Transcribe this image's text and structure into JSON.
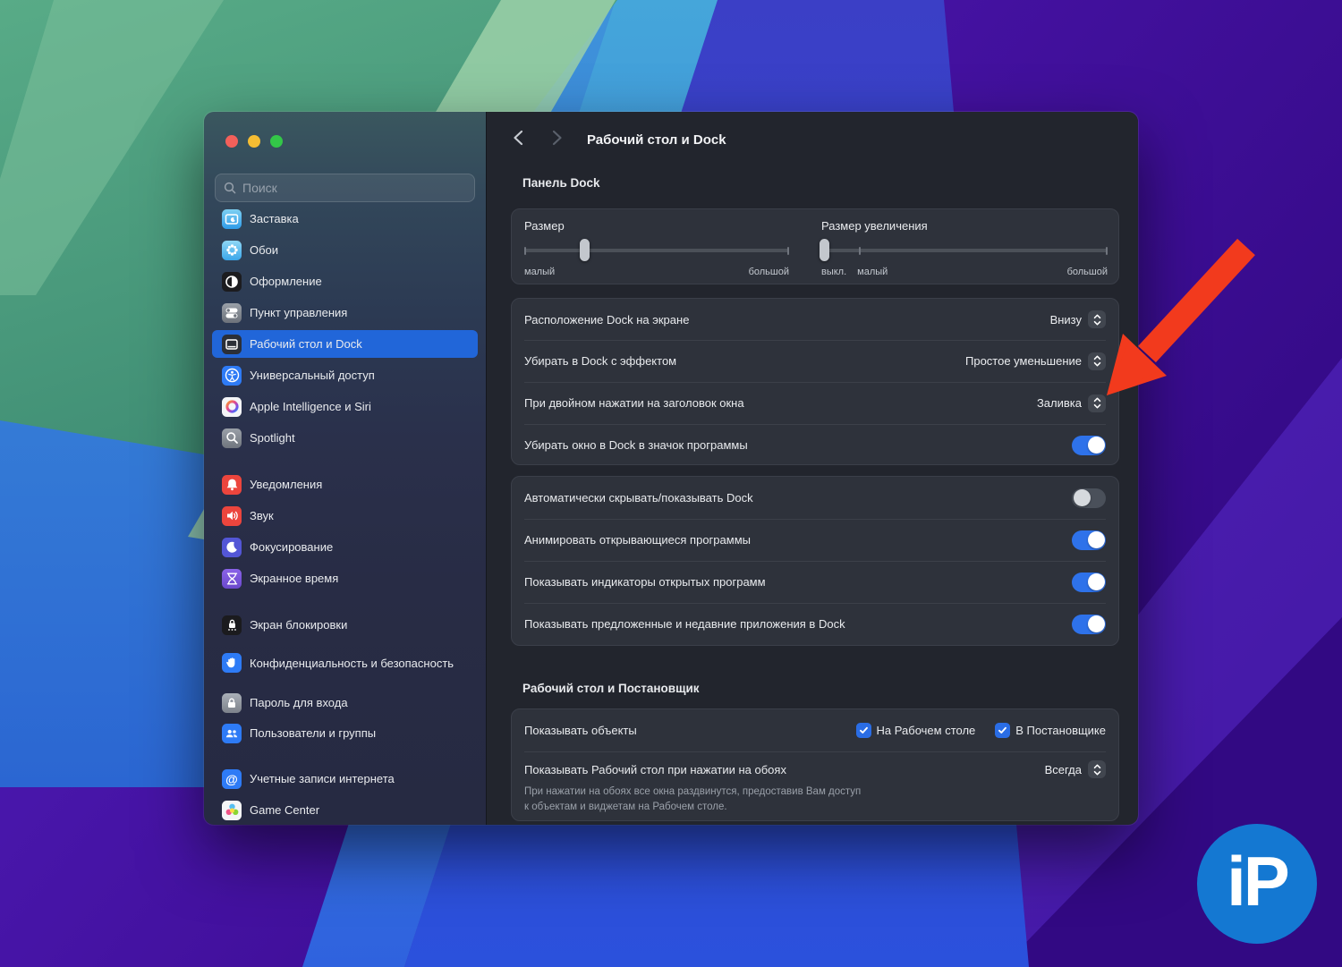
{
  "window": {
    "title": "Рабочий стол и Dock"
  },
  "sidebar": {
    "search_placeholder": "Поиск",
    "items": [
      {
        "label": "Заставка",
        "icon": "screensaver-icon",
        "selected": false
      },
      {
        "label": "Обои",
        "icon": "wallpaper-icon",
        "selected": false
      },
      {
        "label": "Оформление",
        "icon": "appearance-icon",
        "selected": false
      },
      {
        "label": "Пункт управления",
        "icon": "control-center-icon",
        "selected": false
      },
      {
        "label": "Рабочий стол и Dock",
        "icon": "desktop-dock-icon",
        "selected": true
      },
      {
        "label": "Универсальный доступ",
        "icon": "accessibility-icon",
        "selected": false
      },
      {
        "label": "Apple Intelligence и Siri",
        "icon": "apple-intelligence-icon",
        "selected": false
      },
      {
        "label": "Spotlight",
        "icon": "spotlight-icon",
        "selected": false
      },
      {
        "label": "Уведомления",
        "icon": "notifications-icon",
        "selected": false
      },
      {
        "label": "Звук",
        "icon": "sound-icon",
        "selected": false
      },
      {
        "label": "Фокусирование",
        "icon": "focus-icon",
        "selected": false
      },
      {
        "label": "Экранное время",
        "icon": "screen-time-icon",
        "selected": false
      },
      {
        "label": "Экран блокировки",
        "icon": "lock-screen-icon",
        "selected": false
      },
      {
        "label": "Конфиденциальность и безопасность",
        "icon": "privacy-icon",
        "selected": false
      },
      {
        "label": "Пароль для входа",
        "icon": "login-password-icon",
        "selected": false
      },
      {
        "label": "Пользователи и группы",
        "icon": "users-groups-icon",
        "selected": false
      },
      {
        "label": "Учетные записи интернета",
        "icon": "internet-accounts-icon",
        "selected": false
      },
      {
        "label": "Game Center",
        "icon": "game-center-icon",
        "selected": false
      }
    ]
  },
  "content": {
    "header_title": "Рабочий стол и Dock",
    "panel_dock": {
      "section_title": "Панель Dock",
      "size": {
        "label": "Размер",
        "min": "малый",
        "max": "большой",
        "value_pct": 23
      },
      "magnification": {
        "label": "Размер увеличения",
        "off": "выкл.",
        "min": "малый",
        "max": "большой",
        "value_pct": 2
      }
    },
    "dock_rows": [
      {
        "label": "Расположение Dock на экране",
        "value": "Внизу",
        "control": "dropdown"
      },
      {
        "label": "Убирать в Dock с эффектом",
        "value": "Простое уменьшение",
        "control": "dropdown"
      },
      {
        "label": "При двойном нажатии на заголовок окна",
        "value": "Заливка",
        "control": "dropdown"
      },
      {
        "label": "Убирать окно в Dock в значок программы",
        "value": "on",
        "control": "toggle"
      }
    ],
    "toggle_rows": [
      {
        "label": "Автоматически скрывать/показывать Dock",
        "value": "off"
      },
      {
        "label": "Анимировать открывающиеся программы",
        "value": "on"
      },
      {
        "label": "Показывать индикаторы открытых программ",
        "value": "on"
      },
      {
        "label": "Показывать предложенные и недавние приложения в Dock",
        "value": "on"
      }
    ],
    "desktop_stage": {
      "section_title": "Рабочий стол и Постановщик",
      "show_items": {
        "label": "Показывать объекты",
        "cb1": "На Рабочем столе",
        "cb2": "В Постановщике",
        "cb1_checked": true,
        "cb2_checked": true
      },
      "click_wallpaper": {
        "label": "Показывать Рабочий стол при нажатии на обоях",
        "value": "Всегда",
        "desc_line1": "При нажатии на обоях все окна раздвинутся, предоставив Вам доступ",
        "desc_line2": "к объектам и виджетам на Рабочем столе."
      }
    }
  },
  "watermark": {
    "text": "iP"
  },
  "colors": {
    "accent_blue": "#2e72ea",
    "selected_row": "#2166d9",
    "arrow": "#f23a1d",
    "logo_bg": "#1478d2"
  }
}
